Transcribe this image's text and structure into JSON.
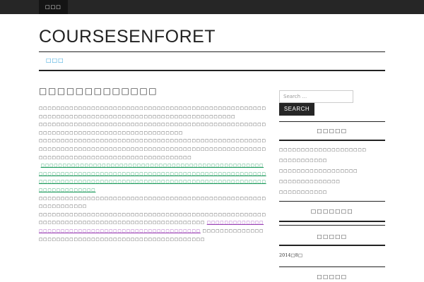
{
  "topbar": {
    "menu_label": "□□□"
  },
  "site": {
    "title": "COURSESENFORET"
  },
  "nav": {
    "items": [
      "□□□"
    ]
  },
  "post": {
    "title": "□□□□□□□□□□□□□",
    "paragraphs": [
      "□□□□□□□□□□□□□□□□□□□□□□□□□□□□□□□□□□□□□□□□□□□□□□□□□□□□□□□□□□□□□□□□□□□□□□□□□□□□□□□□□□□□□□□□□□□□□□□□□",
      "□□□□□□□□□□□□□□□□□□□□□□□□□□□□□□□□□□□□□□□□□□□□□□□□□□□□□□□□□□□□□□□□□□□□□□□□□□□□□□□□□□□□□",
      "□□□□□□□□□□□□□□□□□□□□□□□□□□□□□□□□□□□□□□□□□□□□□□□□□□□□□□□□□□□□□□□□□□□□□□□□□□□□□□□□□□□□□□□□□□□□□□□□□□□□□□□□□□□□□□□□□□□□□□□□□□□□□□□□□□□□□□□□□□□"
    ],
    "link_long": "□□□□□□□□□□□□□□□□□□□□□□□□□□□□□□□□□□□□□□□□□□□□□□□□□□□□□□□□□□□□□□□□□□□□□□□□□□□□□□□□□□□□□□□□□□□□□□□□□□□□□□□□□□□□□□□□□□□□□□□□□□□□□□□□□□□□□□□□□□□□□□□□□□□□□□□□□□□□□□□□□□□□□□□□",
    "paragraph_after": "□□□□□□□□□□□□□□□□□□□□□□□□□□□□□□□□□□□□□□□□□□□□□□□□□□□□□□□□□□□□□□□",
    "paragraph_last_before": "□□□□□□□□□□□□□□□□□□□□□□□□□□□□□□□□□□□□□□□□□□□□□□□□□□□□□□□□□□□□□□□□□□□□□□□□□□□□□□□□□□□□□□□□□□",
    "link_purple": "□□□□□□□□□□□□□□□□□□□□□□□□□□□□□□□□□□□□□□□□□□□□□□□□□□",
    "paragraph_last_after": "□□□□□□□□□□□□□□□□□□□□□□□□□□□□□□□□□□□□□□□□□□□□□□□□□□□□"
  },
  "sidebar": {
    "search_placeholder": "Search …",
    "search_button": "SEARCH",
    "widgets": [
      {
        "title": "□□□□□"
      },
      {
        "title": "□□□□□□□"
      },
      {
        "title": "□□□□□"
      },
      {
        "title": "□□□□□"
      }
    ],
    "recent_posts": [
      "□□□□□□□□□□□□□□□□□□□□",
      "□□□□□□□□□□□",
      "□□□□□□□□□□□□□□□□□□",
      "□□□□□□□□□□□□□□",
      "□□□□□□□□□□□"
    ],
    "archive": "2014□8□"
  },
  "colors": {
    "accent": "#2a9fd8",
    "link_green": "#1a9a5a",
    "link_purple": "#9a3fb4",
    "dark": "#262626"
  }
}
